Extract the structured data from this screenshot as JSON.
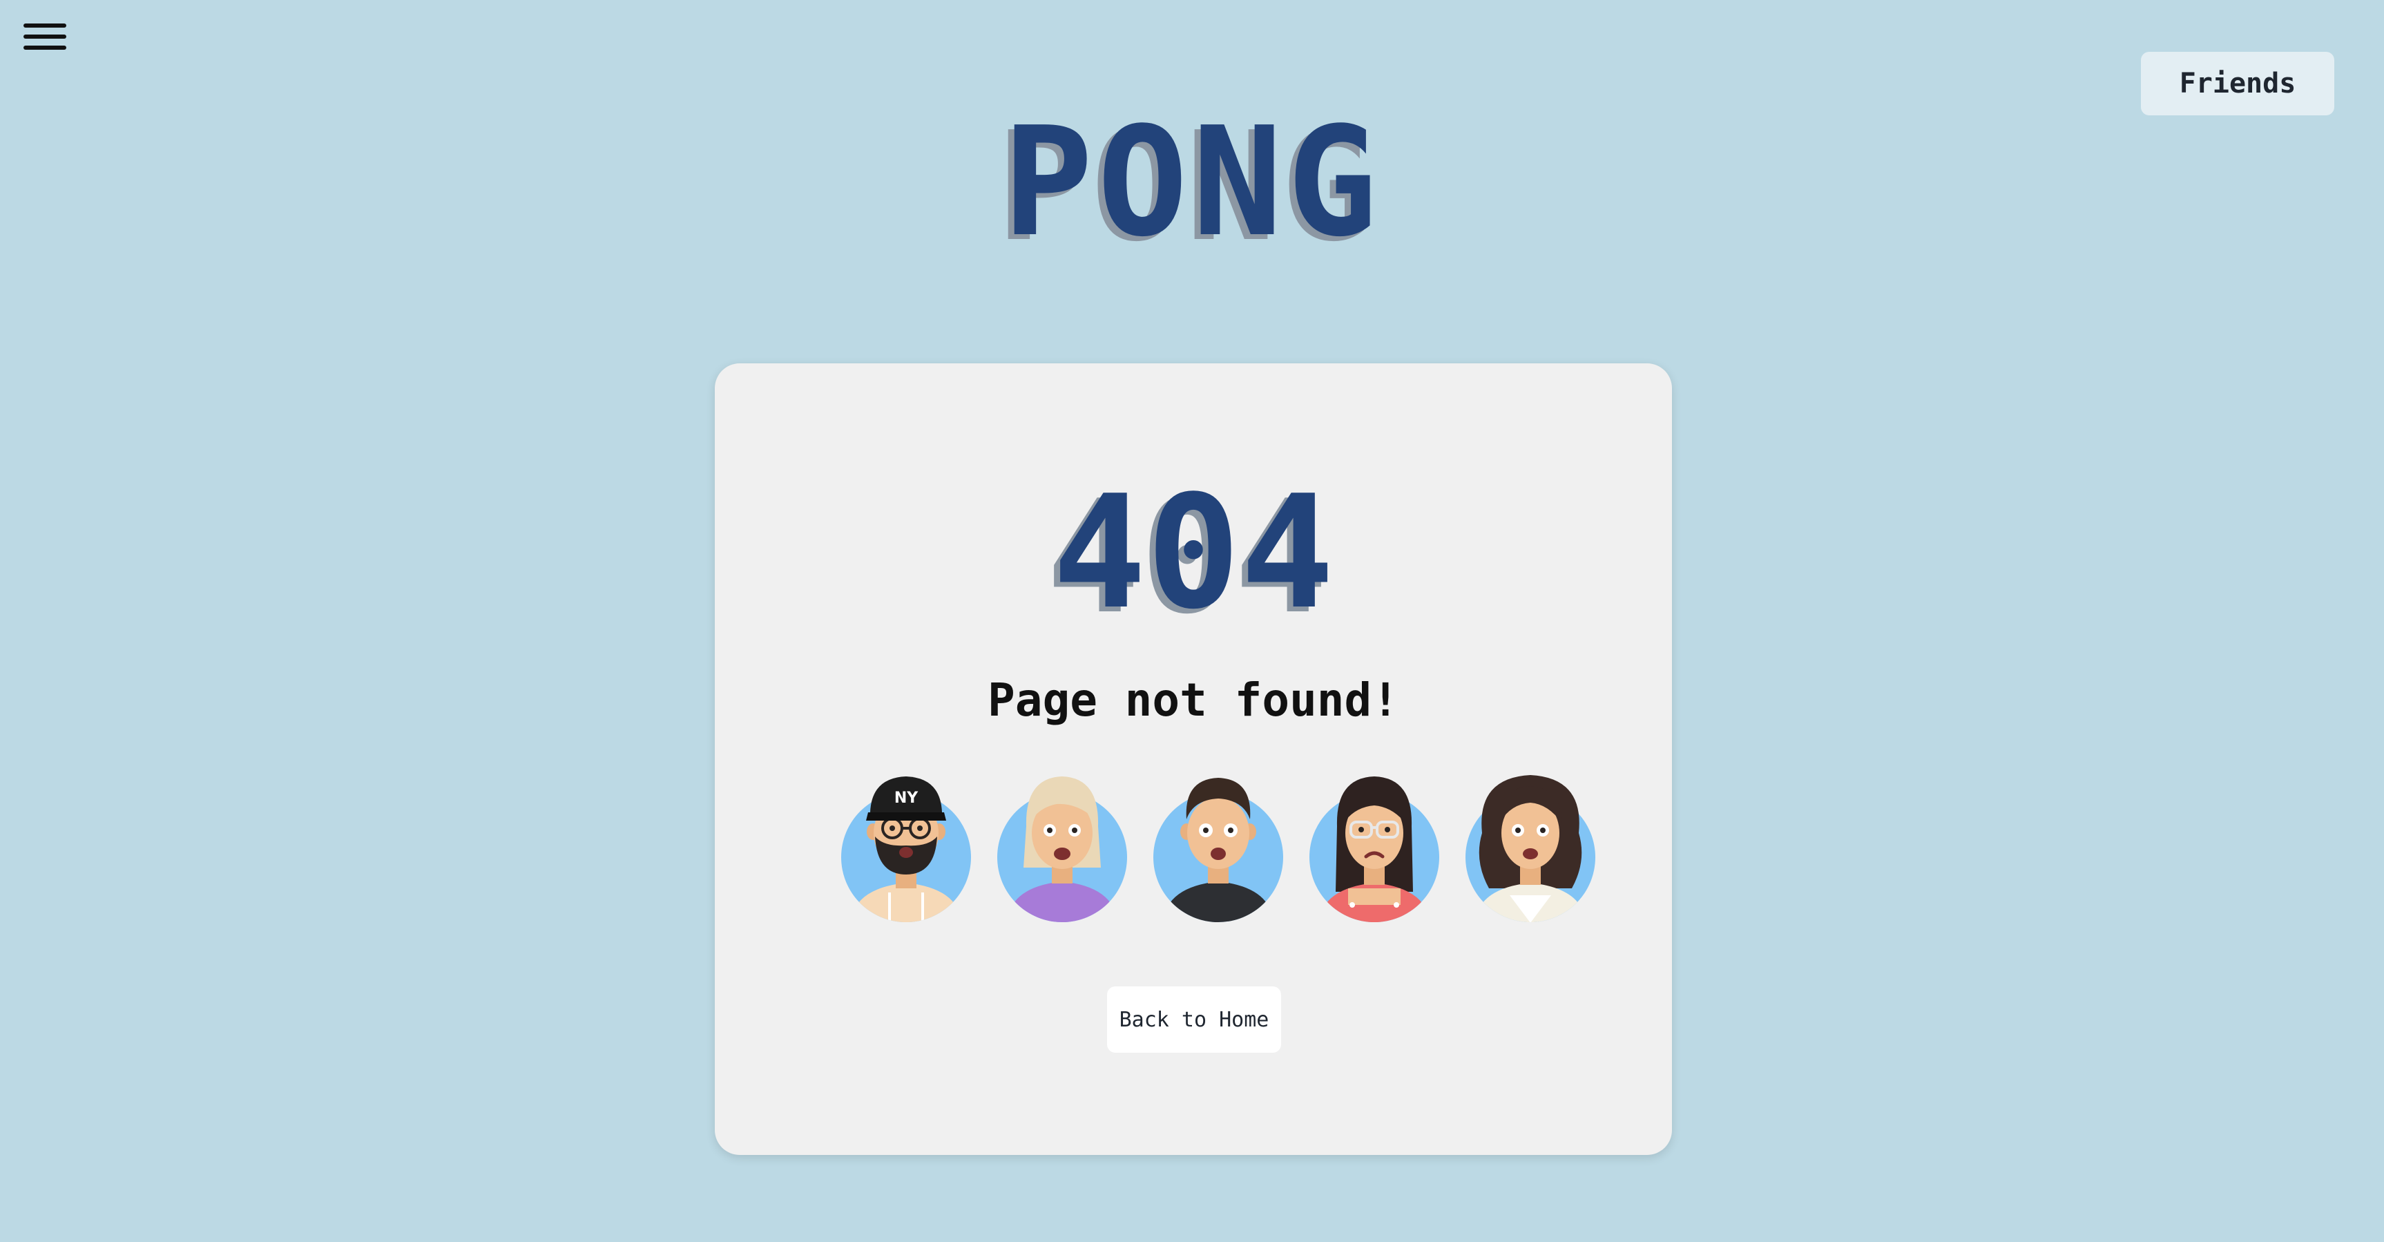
{
  "header": {
    "menu_icon": "hamburger-menu-icon",
    "title": "PONG",
    "friends_label": "Friends"
  },
  "error": {
    "code": "404",
    "message": "Page not found!",
    "back_label": "Back to Home"
  },
  "avatars": [
    {
      "icon": "avatar-bearded-man-cap",
      "shirt_color": "#f6d9b7"
    },
    {
      "icon": "avatar-blonde-woman",
      "shirt_color": "#a77bd8"
    },
    {
      "icon": "avatar-dark-hair-man",
      "shirt_color": "#2d2f33"
    },
    {
      "icon": "avatar-woman-glasses",
      "shirt_color": "#ee6b6b"
    },
    {
      "icon": "avatar-curly-hair-woman",
      "shirt_color": "#f3efe2"
    }
  ],
  "colors": {
    "background": "#bcd9e4",
    "card": "#f0f0f0",
    "title": "#22437a",
    "title_shadow": "#8c97a3",
    "avatar_circle": "#81c4f5"
  }
}
